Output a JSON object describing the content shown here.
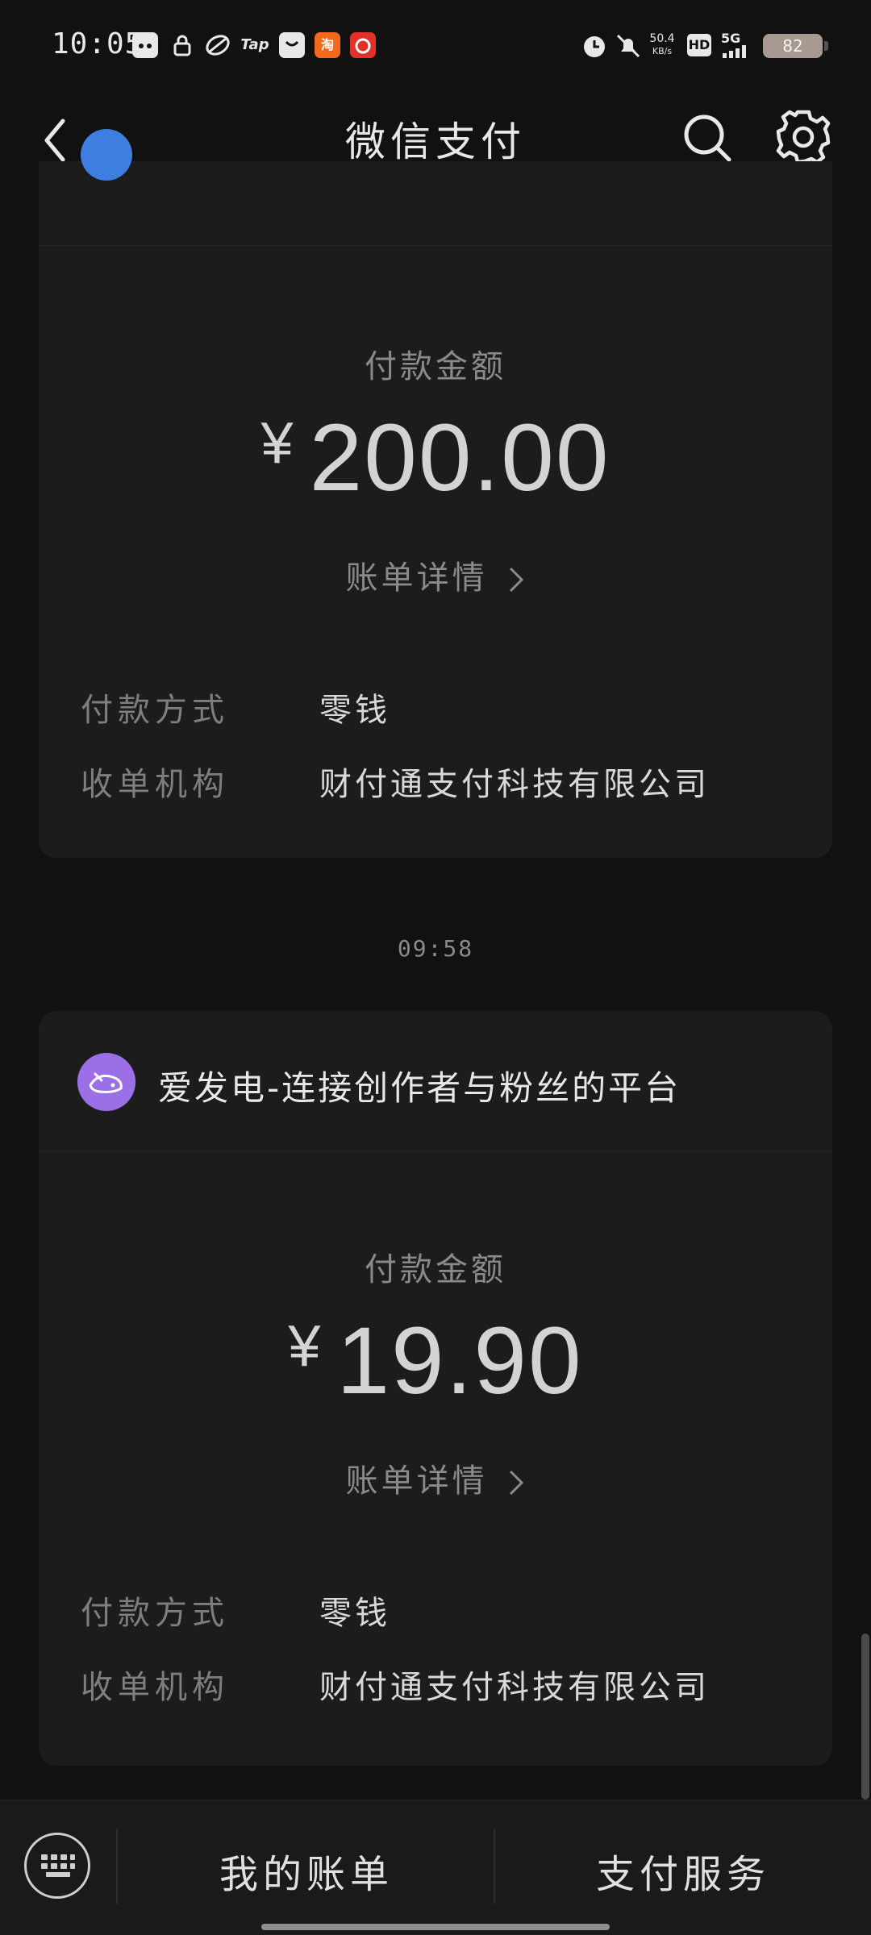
{
  "status_bar": {
    "time": "10:05",
    "app_icons": [
      "cat-app-icon",
      "lock-icon",
      "leaf-app-icon",
      "Tap",
      "mail-app-icon",
      "淘",
      "netease-music-icon"
    ],
    "network_speed_value": "50.4",
    "network_speed_unit": "KB/s",
    "hd_label": "HD",
    "network_type": "5G",
    "battery": "82"
  },
  "nav": {
    "title": "微信支付"
  },
  "transactions": [
    {
      "merchant": "",
      "avatar_color": "#3d7fe0",
      "amount_label": "付款金额",
      "currency": "¥",
      "amount": "200.00",
      "detail_link": "账单详情",
      "payment_method_label": "付款方式",
      "payment_method": "零钱",
      "acquirer_label": "收单机构",
      "acquirer": "财付通支付科技有限公司"
    },
    {
      "time": "09:58",
      "merchant": "爱发电-连接创作者与粉丝的平台",
      "avatar_color": "#9b6fe6",
      "amount_label": "付款金额",
      "currency": "¥",
      "amount": "19.90",
      "detail_link": "账单详情",
      "payment_method_label": "付款方式",
      "payment_method": "零钱",
      "acquirer_label": "收单机构",
      "acquirer": "财付通支付科技有限公司"
    }
  ],
  "bottom_bar": {
    "my_bills": "我的账单",
    "payment_services": "支付服务"
  },
  "colors": {
    "background": "#111111",
    "card": "#1c1c1c",
    "text_primary": "#e8e8e8",
    "text_secondary": "#8a8a8a"
  }
}
